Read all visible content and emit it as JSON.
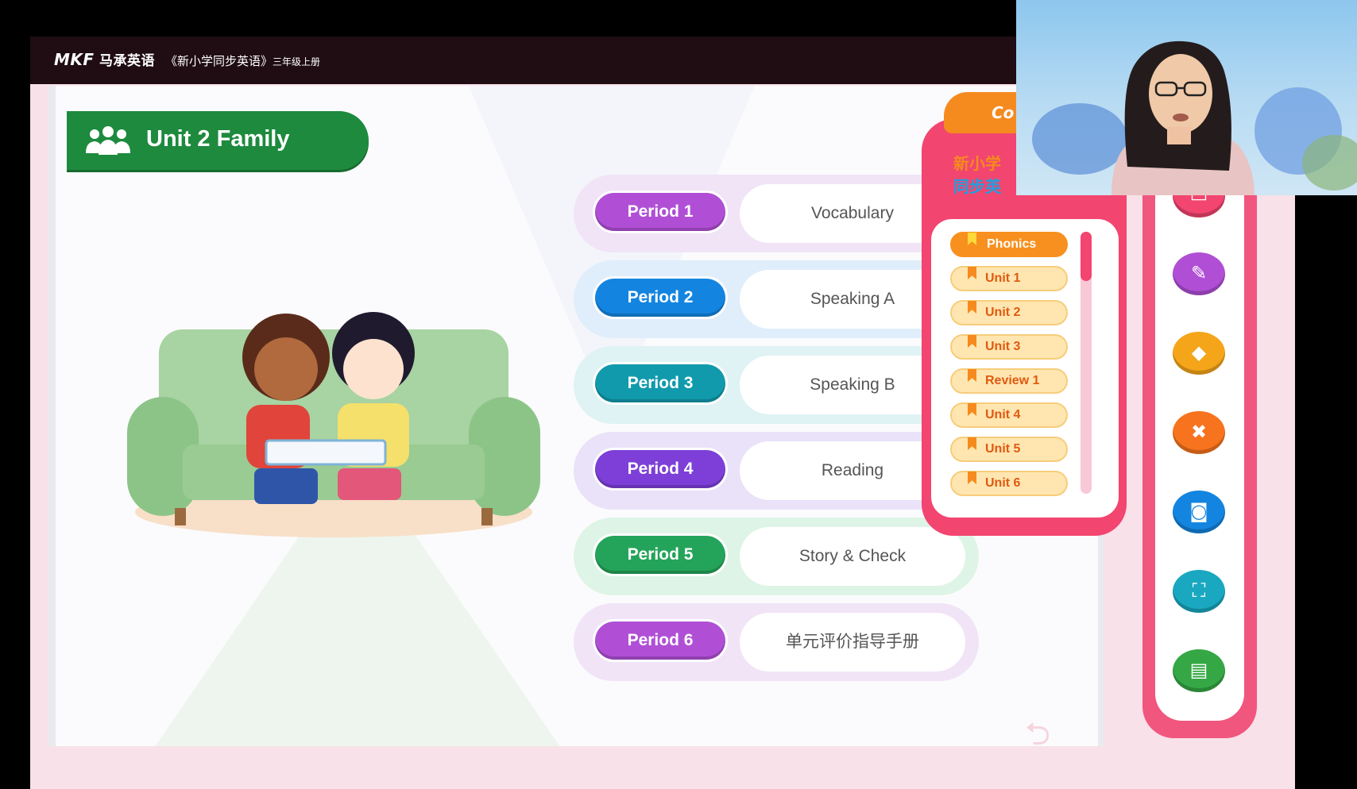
{
  "header": {
    "logo": "MKF",
    "logo_text": "马承英语",
    "title": "《新小学同步英语》",
    "subtitle": "三年级上册"
  },
  "unit_banner": {
    "title": "Unit 2   Family"
  },
  "periods": [
    {
      "label": "Period 1",
      "topic": "Vocabulary",
      "color": "#b04fd6",
      "bg": "#f1e4f7"
    },
    {
      "label": "Period 2",
      "topic": "Speaking  A",
      "color": "#1385e0",
      "bg": "#e0eefb"
    },
    {
      "label": "Period 3",
      "topic": "Speaking  B",
      "color": "#119aac",
      "bg": "#dff2f4"
    },
    {
      "label": "Period 4",
      "topic": "Reading",
      "color": "#7d3fd8",
      "bg": "#e9e2f8"
    },
    {
      "label": "Period 5",
      "topic": "Story & Check",
      "color": "#24a45a",
      "bg": "#def4e6"
    },
    {
      "label": "Period 6",
      "topic": "单元评价指导手册",
      "color": "#b04fd6",
      "bg": "#f1e4f7"
    }
  ],
  "contents_panel": {
    "tab_label": "Co",
    "brand_a": "新小学",
    "brand_b": "同步英",
    "items": [
      "Phonics",
      "Unit 1",
      "Unit 2",
      "Unit 3",
      "Review 1",
      "Unit 4",
      "Unit 5",
      "Unit 6"
    ],
    "active_index": 0
  },
  "toolbar": {
    "tools": [
      {
        "name": "book-icon",
        "glyph": "▭",
        "color": "#f2456f"
      },
      {
        "name": "pen-icon",
        "glyph": "✎",
        "color": "#b04fd6"
      },
      {
        "name": "eraser-icon",
        "glyph": "◆",
        "color": "#f5a51a"
      },
      {
        "name": "close-icon",
        "glyph": "✖",
        "color": "#f7731e"
      },
      {
        "name": "camera-icon",
        "glyph": "◙",
        "color": "#1385e0"
      },
      {
        "name": "screenshot-icon",
        "glyph": "⛶",
        "color": "#1aa8c0"
      },
      {
        "name": "notebook-icon",
        "glyph": "▤",
        "color": "#35a845"
      }
    ]
  }
}
